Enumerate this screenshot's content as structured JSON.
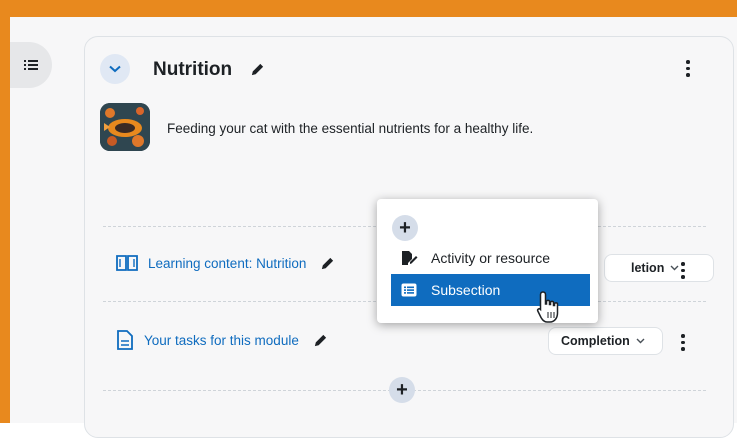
{
  "colors": {
    "frame": "#e8891e",
    "link": "#0f6cbf",
    "menu_active_bg": "#0f6cbf"
  },
  "drawer": {
    "icon": "list-icon"
  },
  "section": {
    "title": "Nutrition",
    "summary": "Feeding your cat with the essential nutrients for a healthy life.",
    "image": "cat-food-image"
  },
  "activities": [
    {
      "name": "Learning content: Nutrition",
      "icon": "book-icon",
      "completion": "Completion"
    },
    {
      "name": "Your tasks for this module",
      "icon": "document-icon",
      "completion": "Completion"
    }
  ],
  "add_menu": {
    "add_symbol": "+",
    "items": [
      {
        "label": "Activity or resource",
        "icon": "file-edit-icon"
      },
      {
        "label": "Subsection",
        "icon": "list-box-icon"
      }
    ]
  },
  "bottom_add": {
    "symbol": "+"
  },
  "visible_partial_label": "letion"
}
